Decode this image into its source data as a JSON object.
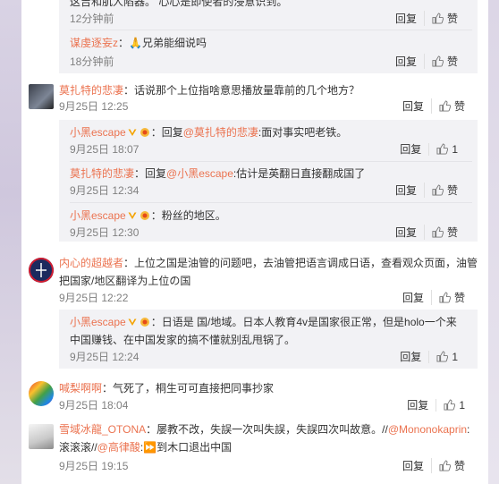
{
  "top_thread": {
    "partial_text": "这吉和肌人陷器。 心心是即使者的浸意识到。",
    "time1": "12分钟前",
    "reply2_user": "谋虔逐妄z",
    "reply2_text": "：🙏兄弟能细说吗",
    "time2": "18分钟前"
  },
  "actions": {
    "reply": "回复",
    "like": "赞",
    "like_one": "1"
  },
  "c1": {
    "user": "莫扎特的悲凄",
    "text": "：话说那个上位指啥意思播放量靠前的几个地方？",
    "time": "9月25日 12:25",
    "replies": [
      {
        "user": "小黑escape",
        "prefix": "：回复",
        "at": "@莫扎特的悲凄",
        "text": ":面对事实吧老铁。",
        "time": "9月25日 18:07",
        "likes": "1"
      },
      {
        "user": "莫扎特的悲凄",
        "prefix": "：回复",
        "at": "@小黑escape",
        "text": ":估计是英翻日直接翻成国了",
        "time": "9月25日 12:34"
      },
      {
        "user": "小黑escape",
        "text": "：粉丝的地区。",
        "time": "9月25日 12:30"
      }
    ]
  },
  "c2": {
    "user": "内心的超越者",
    "text_line1": "：上位之国是油管的问题吧，去油管把语言调成日语，查看观众页面，油管",
    "text_line2": "把国家/地区翻译为上位の国",
    "time": "9月25日 12:22",
    "reply": {
      "user": "小黑escape",
      "text_line1": "：日语是 国/地域。日本人教育4v是国家很正常，但是holo一个来",
      "text_line2": "中国赚钱、在中国发家的搞不懂就别乱甩锅了。",
      "time": "9月25日 12:24",
      "likes": "1"
    }
  },
  "c3": {
    "user": "喊梨啊啊",
    "text": "：气死了，桐生可可直接把同事抄家",
    "time": "9月25日 18:04",
    "likes": "1"
  },
  "c4": {
    "user": "雪域冰龍_OTONA",
    "text_line1a": "：屡教不改，失誤一次叫失誤，失誤四次叫故意。//",
    "at1": "@Mononokaprin",
    "text_line1b": ":",
    "text_line2a": "滚滚滚//",
    "at2": "@高律酸",
    "text_line2b": ":⏩到木口退出中国",
    "time": "9月25日 19:15"
  },
  "colors": {
    "link": "#eb7350",
    "meta": "#808080",
    "sub_bg": "#f2f2f5"
  }
}
